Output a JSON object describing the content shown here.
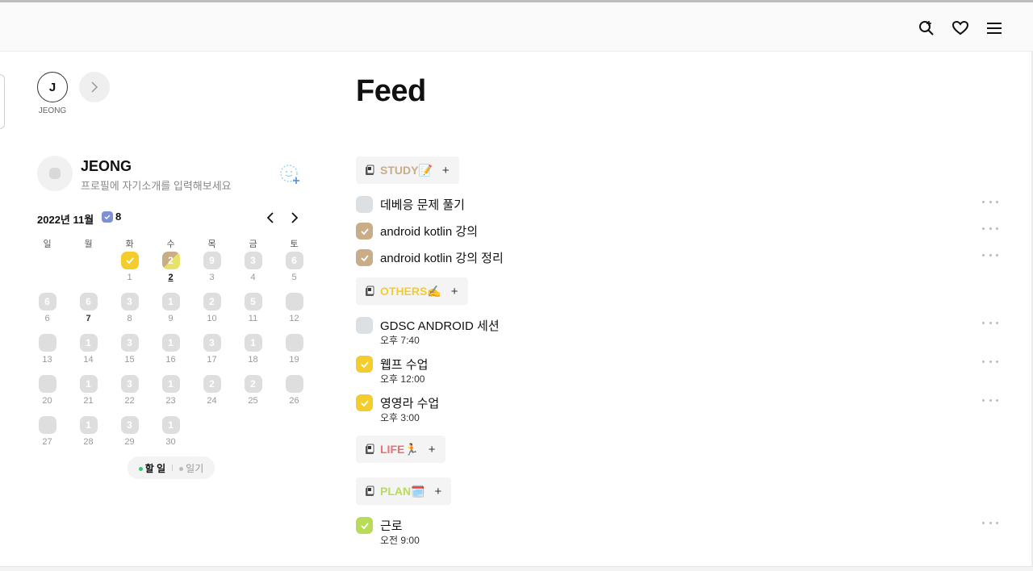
{
  "header": {
    "icons": [
      "search-add-icon",
      "heart-icon",
      "menu-icon"
    ]
  },
  "following": {
    "user_initial": "J",
    "user_label": "JEONG"
  },
  "profile": {
    "name": "JEONG",
    "bio": "프로필에 자기소개를 입력해보세요"
  },
  "calendar": {
    "title": "2022년 11월",
    "badge_count": "8",
    "weekdays": [
      "일",
      "월",
      "화",
      "수",
      "목",
      "금",
      "토"
    ],
    "days": [
      {
        "d": "",
        "n": "",
        "s": "empty"
      },
      {
        "d": "",
        "n": "",
        "s": "empty"
      },
      {
        "d": "1",
        "n": "",
        "s": "yellow-check"
      },
      {
        "d": "2",
        "n": "2",
        "s": "grad",
        "today": true
      },
      {
        "d": "3",
        "n": "9",
        "s": "gray"
      },
      {
        "d": "4",
        "n": "3",
        "s": "gray"
      },
      {
        "d": "5",
        "n": "6",
        "s": "gray"
      },
      {
        "d": "6",
        "n": "6",
        "s": "gray"
      },
      {
        "d": "7",
        "n": "6",
        "s": "gray",
        "bold": true
      },
      {
        "d": "8",
        "n": "3",
        "s": "gray"
      },
      {
        "d": "9",
        "n": "1",
        "s": "gray"
      },
      {
        "d": "10",
        "n": "2",
        "s": "gray"
      },
      {
        "d": "11",
        "n": "5",
        "s": "gray"
      },
      {
        "d": "12",
        "n": "",
        "s": "gray"
      },
      {
        "d": "13",
        "n": "",
        "s": "gray"
      },
      {
        "d": "14",
        "n": "1",
        "s": "gray"
      },
      {
        "d": "15",
        "n": "3",
        "s": "gray"
      },
      {
        "d": "16",
        "n": "1",
        "s": "gray"
      },
      {
        "d": "17",
        "n": "3",
        "s": "gray"
      },
      {
        "d": "18",
        "n": "1",
        "s": "gray"
      },
      {
        "d": "19",
        "n": "",
        "s": "gray"
      },
      {
        "d": "20",
        "n": "",
        "s": "gray"
      },
      {
        "d": "21",
        "n": "1",
        "s": "gray"
      },
      {
        "d": "22",
        "n": "3",
        "s": "gray"
      },
      {
        "d": "23",
        "n": "1",
        "s": "gray"
      },
      {
        "d": "24",
        "n": "2",
        "s": "gray"
      },
      {
        "d": "25",
        "n": "2",
        "s": "gray"
      },
      {
        "d": "26",
        "n": "",
        "s": "gray"
      },
      {
        "d": "27",
        "n": "",
        "s": "gray"
      },
      {
        "d": "28",
        "n": "1",
        "s": "gray"
      },
      {
        "d": "29",
        "n": "3",
        "s": "gray"
      },
      {
        "d": "30",
        "n": "1",
        "s": "gray"
      }
    ],
    "toggle": {
      "todo": "할 일",
      "diary": "일기"
    }
  },
  "feed": {
    "title": "Feed",
    "categories": [
      {
        "name": "STUDY📝",
        "color": "#c8ad86",
        "plus": "+"
      },
      {
        "name": "OTHERS✍️",
        "color": "#f5cc2e",
        "plus": "+"
      },
      {
        "name": "LIFE🏃",
        "color": "#e57373",
        "plus": "+"
      },
      {
        "name": "PLAN🗓️",
        "color": "#b8dc5a",
        "plus": "+"
      }
    ],
    "todos": [
      {
        "title": "데베응 문제 풀기",
        "time": "",
        "status": "empty"
      },
      {
        "title": "android kotlin 강의",
        "time": "",
        "status": "tan"
      },
      {
        "title": "android kotlin 강의 정리",
        "time": "",
        "status": "tan"
      },
      {
        "title": "GDSC ANDROID 세션",
        "time": "오후 7:40",
        "status": "empty"
      },
      {
        "title": "웹프 수업",
        "time": "오후 12:00",
        "status": "yellow"
      },
      {
        "title": "영영라 수업",
        "time": "오후 3:00",
        "status": "yellow"
      },
      {
        "title": "근로",
        "time": "오전 9:00",
        "status": "green"
      }
    ]
  }
}
